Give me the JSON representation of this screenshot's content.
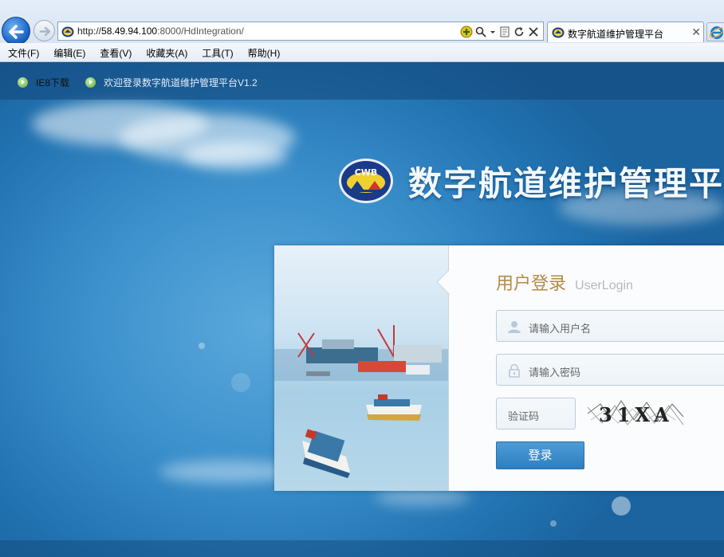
{
  "browser": {
    "url_prefix": "http://",
    "url_host": "58.49.94.100",
    "url_rest": ":8000/HdIntegration/",
    "tab_title": "数字航道维护管理平台",
    "tab_close": "✕",
    "menu": [
      "文件(F)",
      "编辑(E)",
      "查看(V)",
      "收藏夹(A)",
      "工具(T)",
      "帮助(H)"
    ]
  },
  "topbar": {
    "ie8_link": "IE8下载",
    "welcome": "欢迎登录数字航道维护管理平台V1.2"
  },
  "brand": {
    "logo_text": "CWB",
    "title": "数字航道维护管理平台"
  },
  "login": {
    "title": "用户登录",
    "subtitle": "UserLogin",
    "username_placeholder": "请输入用户名",
    "password_placeholder": "请输入密码",
    "captcha_placeholder": "验证码",
    "captcha_text": "31XA",
    "submit_label": "登录"
  },
  "colors": {
    "accent_gold": "#b28a4a",
    "button_blue": "#3a8ac8",
    "page_blue": "#2a7ab8"
  }
}
